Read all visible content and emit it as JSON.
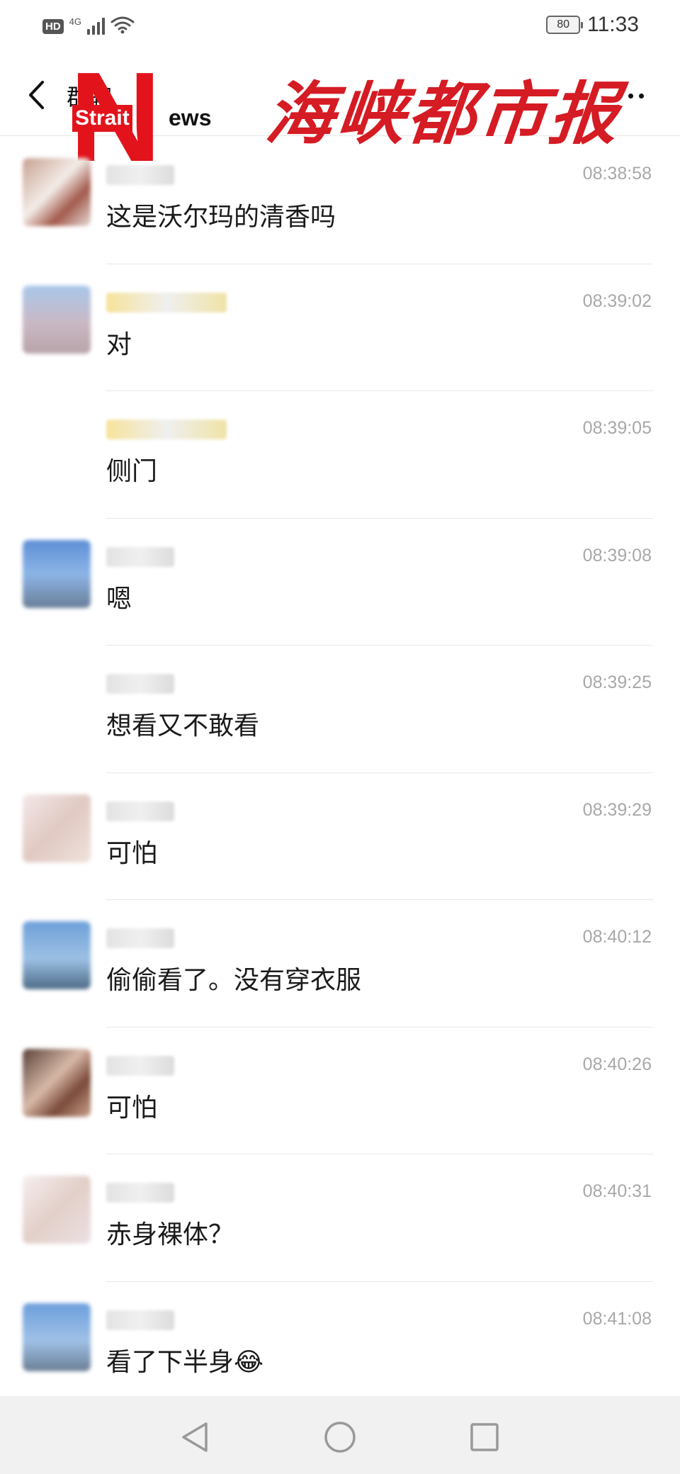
{
  "status_bar": {
    "hd": "HD",
    "network": "4G",
    "battery": "80",
    "time": "11:33"
  },
  "header": {
    "title": "群聊",
    "back_icon": "chevron-left-icon",
    "more_icon": "more-dots-icon"
  },
  "watermark": {
    "letter": "N",
    "strait": "Strait",
    "ews": "ews",
    "chinese": "海峡都市报",
    "color": "#e3131b"
  },
  "messages": [
    {
      "time": "08:38:58",
      "text": "这是沃尔玛的清香吗"
    },
    {
      "time": "08:39:02",
      "text": "对"
    },
    {
      "time": "08:39:05",
      "text": "侧门"
    },
    {
      "time": "08:39:08",
      "text": "嗯"
    },
    {
      "time": "08:39:25",
      "text": "想看又不敢看"
    },
    {
      "time": "08:39:29",
      "text": "可怕"
    },
    {
      "time": "08:40:12",
      "text": "偷偷看了。没有穿衣服"
    },
    {
      "time": "08:40:26",
      "text": "可怕"
    },
    {
      "time": "08:40:31",
      "text": "赤身裸体？"
    },
    {
      "time": "08:41:08",
      "text": "看了下半身😂"
    }
  ],
  "navbar": {
    "back_icon": "triangle-back-icon",
    "home_icon": "circle-home-icon",
    "recent_icon": "square-recent-icon",
    "background": "#f1f1f1"
  }
}
